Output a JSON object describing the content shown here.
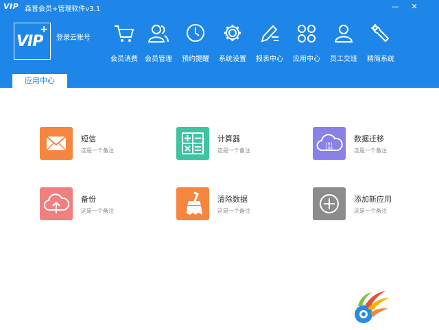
{
  "window": {
    "logo": "VIP",
    "title": "森普会员+管理软件v3.1",
    "minimize": "—",
    "close": "✕"
  },
  "header": {
    "logo_text": "VIP",
    "logo_plus": "+",
    "login": "登录云账号"
  },
  "nav": [
    {
      "label": "会员消费",
      "icon": "cart-icon"
    },
    {
      "label": "会员管理",
      "icon": "users-icon"
    },
    {
      "label": "预约提醒",
      "icon": "clock-icon"
    },
    {
      "label": "系统设置",
      "icon": "gear-icon"
    },
    {
      "label": "报表中心",
      "icon": "pen-icon"
    },
    {
      "label": "应用中心",
      "icon": "apps-icon"
    },
    {
      "label": "员工交班",
      "icon": "person-icon"
    },
    {
      "label": "精简系统",
      "icon": "wrench-icon"
    }
  ],
  "tab": {
    "label": "应用中心"
  },
  "apps": [
    {
      "name": "短信",
      "note": "这是一个备注",
      "icon": "mail-icon",
      "color": "#f5853f"
    },
    {
      "name": "计算器",
      "note": "这是一个备注",
      "icon": "calculator-icon",
      "color": "#3fc3a1"
    },
    {
      "name": "数据迁移",
      "note": "这是一个备注",
      "icon": "cloud-data-icon",
      "color": "#8b7fe8"
    },
    {
      "name": "备份",
      "note": "这是一个备注",
      "icon": "cloud-upload-icon",
      "color": "#f27f7f"
    },
    {
      "name": "清除数据",
      "note": "这是一个备注",
      "icon": "broom-icon",
      "color": "#f5853f"
    },
    {
      "name": "添加新应用",
      "note": "这是一个备注",
      "icon": "add-icon",
      "color": "#8c8c8c"
    }
  ],
  "colors": {
    "header": "#1e86e8",
    "background": "#ffffff"
  }
}
